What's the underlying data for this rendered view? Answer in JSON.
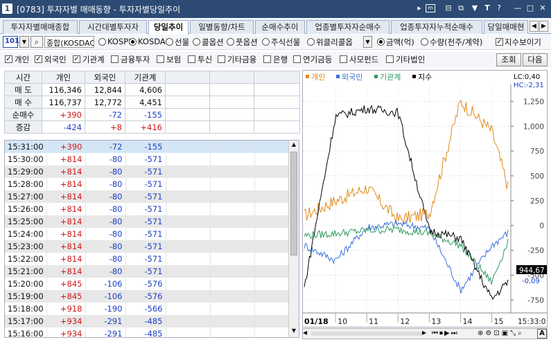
{
  "title": {
    "number": "1",
    "text": "[0783] 투자자별 매매동향 - 투자자별당일추이"
  },
  "titlebar_icons": [
    "play-icon",
    "monitor-icon",
    "layout-icon",
    "copy-icon",
    "pin-icon",
    "font-icon",
    "help-icon",
    "minimize-icon",
    "maximize-icon",
    "close-icon"
  ],
  "tabs": [
    "투자자별매매종합",
    "시간대별투자자",
    "당일추이",
    "일별동향/차트",
    "순매수추이",
    "업종별투자자순매수",
    "업종투자자누적순매수",
    "당일매매현"
  ],
  "active_tab": 2,
  "row1": {
    "code_value": "101",
    "market_value": "종합(KOSDAQ",
    "radio_kospi": "KOSPI",
    "radio_kosdaq": "KOSDAQ",
    "radio_futures": "선물",
    "radio_call": "콜옵션",
    "radio_put": "풋옵션",
    "radio_stock_futures": "주식선물",
    "radio_weekly": "위클리콜옵",
    "radio_amount": "금액(억)",
    "radio_qty": "수량(천주/계약)",
    "index_view": "지수보이기"
  },
  "row2": {
    "cb_individual": "개인",
    "cb_foreign": "외국인",
    "cb_institution": "기관계",
    "cb_fin_invest": "금융투자",
    "cb_insurance": "보험",
    "cb_trust": "투신",
    "cb_other_fin": "기타금융",
    "cb_bank": "은행",
    "cb_pension": "연기금등",
    "cb_private": "사모펀드",
    "cb_other_corp": "기타법인",
    "btn_query": "조회",
    "btn_next": "다음"
  },
  "summary": {
    "headers": [
      "시간",
      "개인",
      "외국인",
      "기관계"
    ],
    "rows": [
      {
        "label": "매 도",
        "v1": "116,346",
        "v2": "12,844",
        "v3": "4,606"
      },
      {
        "label": "매 수",
        "v1": "116,737",
        "v2": "12,772",
        "v3": "4,451"
      },
      {
        "label": "순매수",
        "v1": "+390",
        "v2": "-72",
        "v3": "-155"
      },
      {
        "label": "증감",
        "v1": "-424",
        "v2": "+8",
        "v3": "+416"
      }
    ]
  },
  "timeline": [
    {
      "t": "15:31:00",
      "a": "+390",
      "b": "-72",
      "c": "-155"
    },
    {
      "t": "15:30:00",
      "a": "+814",
      "b": "-80",
      "c": "-571"
    },
    {
      "t": "15:29:00",
      "a": "+814",
      "b": "-80",
      "c": "-571"
    },
    {
      "t": "15:28:00",
      "a": "+814",
      "b": "-80",
      "c": "-571"
    },
    {
      "t": "15:27:00",
      "a": "+814",
      "b": "-80",
      "c": "-571"
    },
    {
      "t": "15:26:00",
      "a": "+814",
      "b": "-80",
      "c": "-571"
    },
    {
      "t": "15:25:00",
      "a": "+814",
      "b": "-80",
      "c": "-571"
    },
    {
      "t": "15:24:00",
      "a": "+814",
      "b": "-80",
      "c": "-571"
    },
    {
      "t": "15:23:00",
      "a": "+814",
      "b": "-80",
      "c": "-571"
    },
    {
      "t": "15:22:00",
      "a": "+814",
      "b": "-80",
      "c": "-571"
    },
    {
      "t": "15:21:00",
      "a": "+814",
      "b": "-80",
      "c": "-571"
    },
    {
      "t": "15:20:00",
      "a": "+845",
      "b": "-106",
      "c": "-576"
    },
    {
      "t": "15:19:00",
      "a": "+845",
      "b": "-106",
      "c": "-576"
    },
    {
      "t": "15:18:00",
      "a": "+918",
      "b": "-190",
      "c": "-566"
    },
    {
      "t": "15:17:00",
      "a": "+934",
      "b": "-291",
      "c": "-485"
    },
    {
      "t": "15:16:00",
      "a": "+934",
      "b": "-291",
      "c": "-485"
    }
  ],
  "chart": {
    "legend": [
      {
        "name": "개인",
        "color": "#e08a1a"
      },
      {
        "name": "외국인",
        "color": "#3a6fd8"
      },
      {
        "name": "기관계",
        "color": "#2a9a5a"
      },
      {
        "name": "지수",
        "color": "#000000"
      }
    ],
    "lc_label": "LC:0,40",
    "hc_label": "HC:-2,31",
    "index_value": "944,67",
    "index_pct": "-0,09",
    "date_label": "01/18",
    "x_ticks": [
      "10",
      "11",
      "12",
      "13",
      "14",
      "15"
    ],
    "time_end": "15:33:0",
    "y_ticks": [
      "1,250",
      "1,000",
      "750",
      "500",
      "250",
      "0",
      "-250",
      "-500",
      "-750"
    ]
  },
  "chart_data": {
    "type": "line",
    "ylim": [
      -880,
      1420
    ],
    "x": [
      "09:00",
      "10:00",
      "11:00",
      "12:00",
      "13:00",
      "14:00",
      "15:00",
      "15:31"
    ],
    "series": [
      {
        "name": "개인",
        "values": [
          100,
          250,
          380,
          60,
          120,
          1250,
          950,
          390
        ]
      },
      {
        "name": "외국인",
        "values": [
          -200,
          -350,
          -20,
          20,
          -30,
          -650,
          -200,
          -72
        ]
      },
      {
        "name": "기관계",
        "values": [
          -100,
          -80,
          -50,
          -40,
          -80,
          -200,
          -571,
          -155
        ]
      },
      {
        "name": "지수",
        "values": [
          944.5,
          949.0,
          949.2,
          949.1,
          946.0,
          945.8,
          944.2,
          944.67
        ]
      }
    ]
  }
}
